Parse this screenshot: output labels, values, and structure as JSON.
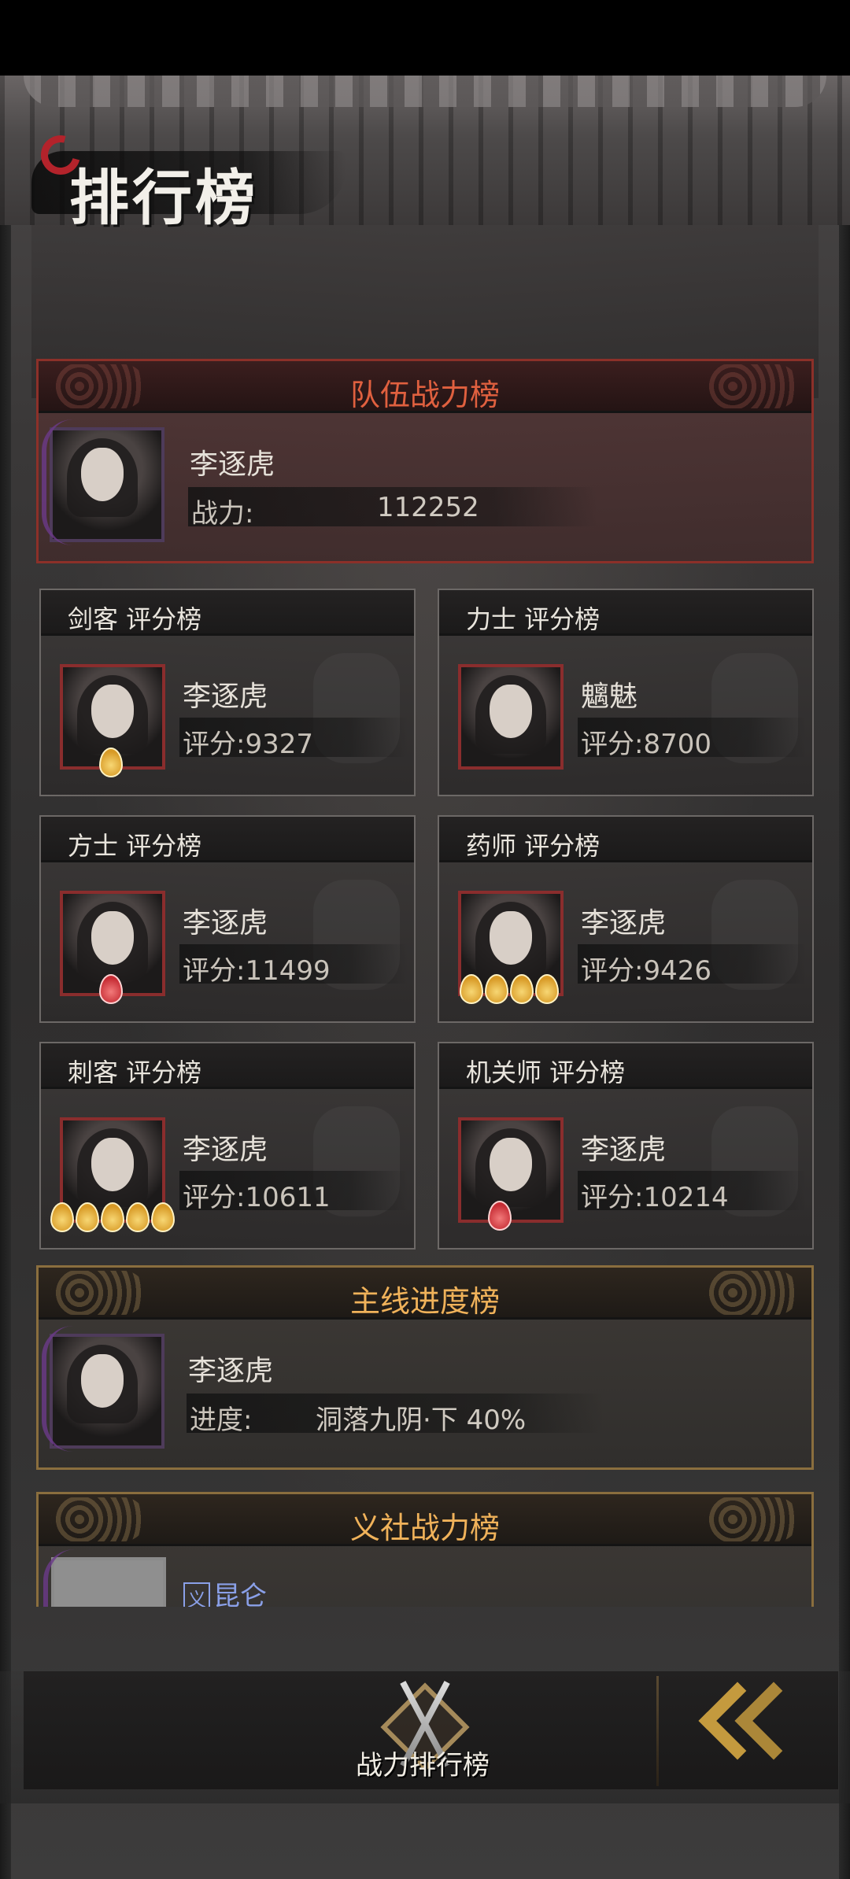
{
  "header": {
    "title": "排行榜"
  },
  "team_power": {
    "title": "队伍战力榜",
    "name": "李逐虎",
    "stat_label": "战力:",
    "stat_value": "112252"
  },
  "class_boards": [
    {
      "title": "剑客 评分榜",
      "name": "李逐虎",
      "score": "评分:9327"
    },
    {
      "title": "力士 评分榜",
      "name": "魑魅",
      "score": "评分:8700"
    },
    {
      "title": "方士 评分榜",
      "name": "李逐虎",
      "score": "评分:11499"
    },
    {
      "title": "药师 评分榜",
      "name": "李逐虎",
      "score": "评分:9426"
    },
    {
      "title": "刺客 评分榜",
      "name": "李逐虎",
      "score": "评分:10611"
    },
    {
      "title": "机关师 评分榜",
      "name": "李逐虎",
      "score": "评分:10214"
    }
  ],
  "main_progress": {
    "title": "主线进度榜",
    "name": "李逐虎",
    "stat_label": "进度:",
    "stat_value": "洞落九阴·下  40%"
  },
  "guild_power": {
    "title": "义社战力榜",
    "guild_tag": "义",
    "name": "昆仑"
  },
  "bottom_tab": {
    "label": "战力排行榜"
  },
  "colors": {
    "accent_red": "#e0603f",
    "accent_gold": "#f0b25a",
    "badge_gold": "#d89a26",
    "badge_red": "#c62c34"
  }
}
